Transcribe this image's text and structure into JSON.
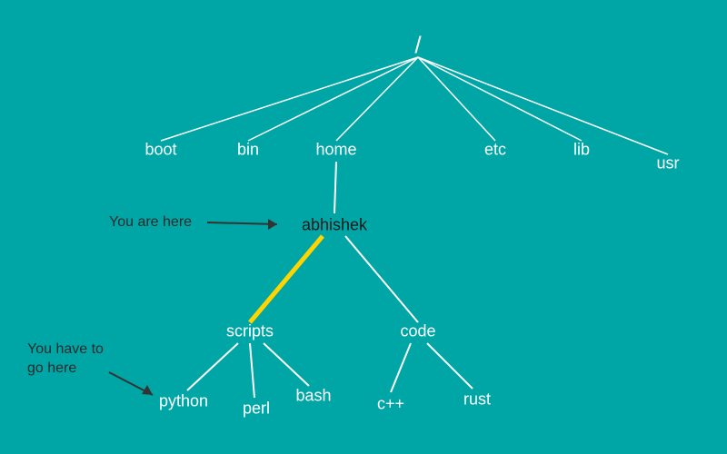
{
  "root": "/",
  "level1": {
    "boot": "boot",
    "bin": "bin",
    "home": "home",
    "etc": "etc",
    "lib": "lib",
    "usr": "usr"
  },
  "level2": {
    "abhishek": "abhishek"
  },
  "level3": {
    "scripts": "scripts",
    "code": "code"
  },
  "level4": {
    "python": "python",
    "perl": "perl",
    "bash": "bash",
    "cpp": "c++",
    "rust": "rust"
  },
  "annotations": {
    "here": "You are here",
    "go": "You have to\ngo here"
  }
}
